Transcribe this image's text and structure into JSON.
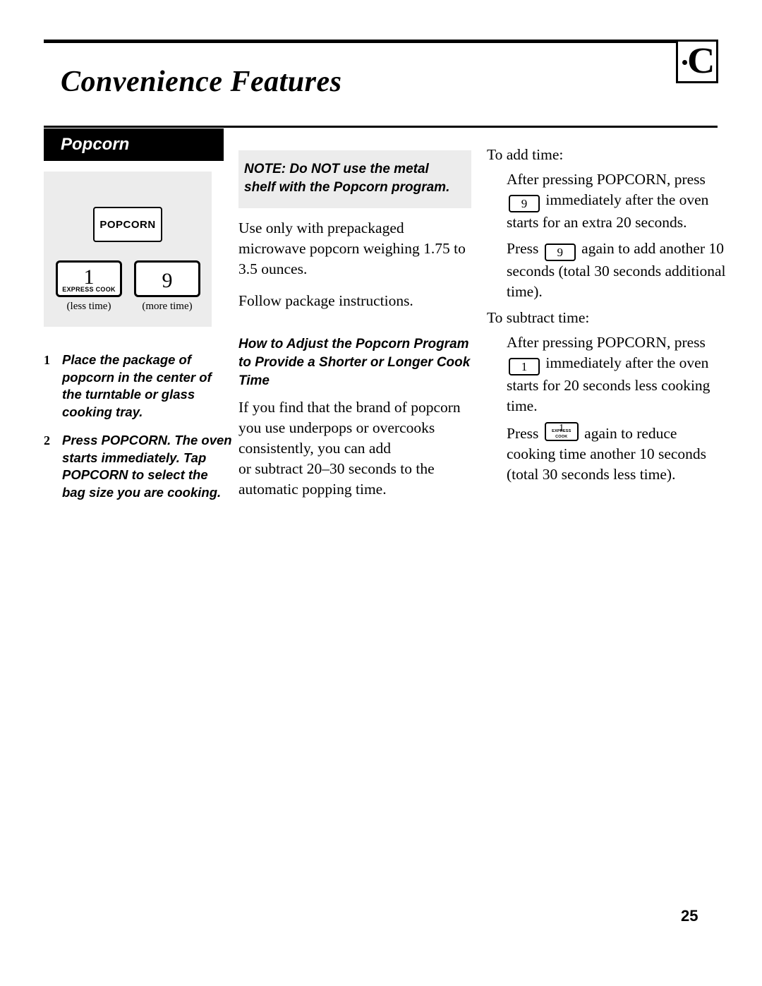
{
  "header": {
    "title": "Convenience Features",
    "logo_glyph": "C"
  },
  "section": {
    "title": "Popcorn"
  },
  "keypad": {
    "popcorn_key_label": "POPCORN",
    "left_key_digit": "1",
    "left_key_sub": "EXPRESS COOK",
    "right_key_digit": "9",
    "caption_left": "(less time)",
    "caption_right": "(more time)"
  },
  "steps": [
    {
      "num": "1",
      "text": "Place the package of popcorn in the center of the turntable or glass cooking tray."
    },
    {
      "num": "2",
      "text": "Press POPCORN. The oven starts immediately. Tap POPCORN to select the bag size you are cooking."
    }
  ],
  "column2": {
    "note": "NOTE: Do NOT use the metal shelf with the Popcorn program.",
    "para1": "Use only with prepackaged microwave popcorn weighing 1.75 to 3.5 ounces.",
    "para2": "Follow package instructions.",
    "subhead": "How to Adjust the Popcorn Program to Provide a Shorter or Longer Cook Time",
    "para3": "If you find that the brand of popcorn you use underpops or overcooks consistently, you can add",
    "para4": "or subtract 20–30 seconds to the automatic popping time."
  },
  "column3": {
    "add_lead": "To add time:",
    "add_line1a": "After pressing POPCORN, press",
    "add_key1": "9",
    "add_line1b": "immediately after the oven starts for an extra 20 seconds.",
    "add_line2a": "Press",
    "add_key2": "9",
    "add_line2b": "again to add another 10 seconds (total 30 seconds additional time).",
    "sub_lead": "To subtract time:",
    "sub_line1a": "After pressing POPCORN, press",
    "sub_key1": "1",
    "sub_line1b": "immediately after the oven starts for 20 seconds less cooking time.",
    "sub_line2a": "Press",
    "sub_key2": "1",
    "sub_key2_sub": "EXPRESS COOK",
    "sub_line2b": "again to reduce cooking time another 10 seconds (total 30 seconds less time)."
  },
  "footer": {
    "page_number": "25"
  }
}
